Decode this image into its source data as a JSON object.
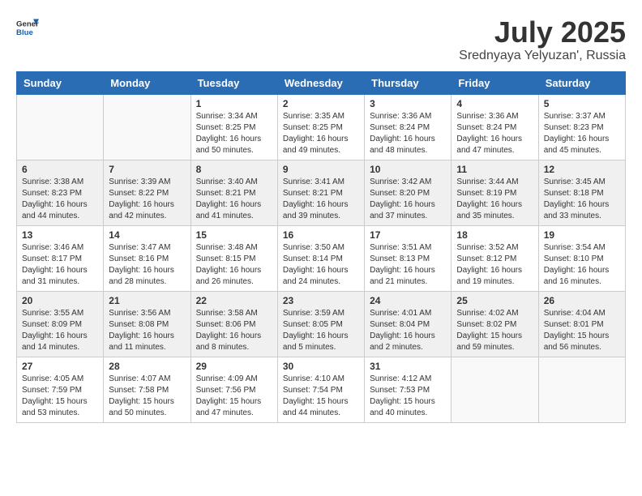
{
  "header": {
    "logo_line1": "General",
    "logo_line2": "Blue",
    "month_year": "July 2025",
    "location": "Srednyaya Yelyuzan', Russia"
  },
  "weekdays": [
    "Sunday",
    "Monday",
    "Tuesday",
    "Wednesday",
    "Thursday",
    "Friday",
    "Saturday"
  ],
  "weeks": [
    [
      {
        "day": "",
        "sunrise": "",
        "sunset": "",
        "daylight": ""
      },
      {
        "day": "",
        "sunrise": "",
        "sunset": "",
        "daylight": ""
      },
      {
        "day": "1",
        "sunrise": "Sunrise: 3:34 AM",
        "sunset": "Sunset: 8:25 PM",
        "daylight": "Daylight: 16 hours and 50 minutes."
      },
      {
        "day": "2",
        "sunrise": "Sunrise: 3:35 AM",
        "sunset": "Sunset: 8:25 PM",
        "daylight": "Daylight: 16 hours and 49 minutes."
      },
      {
        "day": "3",
        "sunrise": "Sunrise: 3:36 AM",
        "sunset": "Sunset: 8:24 PM",
        "daylight": "Daylight: 16 hours and 48 minutes."
      },
      {
        "day": "4",
        "sunrise": "Sunrise: 3:36 AM",
        "sunset": "Sunset: 8:24 PM",
        "daylight": "Daylight: 16 hours and 47 minutes."
      },
      {
        "day": "5",
        "sunrise": "Sunrise: 3:37 AM",
        "sunset": "Sunset: 8:23 PM",
        "daylight": "Daylight: 16 hours and 45 minutes."
      }
    ],
    [
      {
        "day": "6",
        "sunrise": "Sunrise: 3:38 AM",
        "sunset": "Sunset: 8:23 PM",
        "daylight": "Daylight: 16 hours and 44 minutes."
      },
      {
        "day": "7",
        "sunrise": "Sunrise: 3:39 AM",
        "sunset": "Sunset: 8:22 PM",
        "daylight": "Daylight: 16 hours and 42 minutes."
      },
      {
        "day": "8",
        "sunrise": "Sunrise: 3:40 AM",
        "sunset": "Sunset: 8:21 PM",
        "daylight": "Daylight: 16 hours and 41 minutes."
      },
      {
        "day": "9",
        "sunrise": "Sunrise: 3:41 AM",
        "sunset": "Sunset: 8:21 PM",
        "daylight": "Daylight: 16 hours and 39 minutes."
      },
      {
        "day": "10",
        "sunrise": "Sunrise: 3:42 AM",
        "sunset": "Sunset: 8:20 PM",
        "daylight": "Daylight: 16 hours and 37 minutes."
      },
      {
        "day": "11",
        "sunrise": "Sunrise: 3:44 AM",
        "sunset": "Sunset: 8:19 PM",
        "daylight": "Daylight: 16 hours and 35 minutes."
      },
      {
        "day": "12",
        "sunrise": "Sunrise: 3:45 AM",
        "sunset": "Sunset: 8:18 PM",
        "daylight": "Daylight: 16 hours and 33 minutes."
      }
    ],
    [
      {
        "day": "13",
        "sunrise": "Sunrise: 3:46 AM",
        "sunset": "Sunset: 8:17 PM",
        "daylight": "Daylight: 16 hours and 31 minutes."
      },
      {
        "day": "14",
        "sunrise": "Sunrise: 3:47 AM",
        "sunset": "Sunset: 8:16 PM",
        "daylight": "Daylight: 16 hours and 28 minutes."
      },
      {
        "day": "15",
        "sunrise": "Sunrise: 3:48 AM",
        "sunset": "Sunset: 8:15 PM",
        "daylight": "Daylight: 16 hours and 26 minutes."
      },
      {
        "day": "16",
        "sunrise": "Sunrise: 3:50 AM",
        "sunset": "Sunset: 8:14 PM",
        "daylight": "Daylight: 16 hours and 24 minutes."
      },
      {
        "day": "17",
        "sunrise": "Sunrise: 3:51 AM",
        "sunset": "Sunset: 8:13 PM",
        "daylight": "Daylight: 16 hours and 21 minutes."
      },
      {
        "day": "18",
        "sunrise": "Sunrise: 3:52 AM",
        "sunset": "Sunset: 8:12 PM",
        "daylight": "Daylight: 16 hours and 19 minutes."
      },
      {
        "day": "19",
        "sunrise": "Sunrise: 3:54 AM",
        "sunset": "Sunset: 8:10 PM",
        "daylight": "Daylight: 16 hours and 16 minutes."
      }
    ],
    [
      {
        "day": "20",
        "sunrise": "Sunrise: 3:55 AM",
        "sunset": "Sunset: 8:09 PM",
        "daylight": "Daylight: 16 hours and 14 minutes."
      },
      {
        "day": "21",
        "sunrise": "Sunrise: 3:56 AM",
        "sunset": "Sunset: 8:08 PM",
        "daylight": "Daylight: 16 hours and 11 minutes."
      },
      {
        "day": "22",
        "sunrise": "Sunrise: 3:58 AM",
        "sunset": "Sunset: 8:06 PM",
        "daylight": "Daylight: 16 hours and 8 minutes."
      },
      {
        "day": "23",
        "sunrise": "Sunrise: 3:59 AM",
        "sunset": "Sunset: 8:05 PM",
        "daylight": "Daylight: 16 hours and 5 minutes."
      },
      {
        "day": "24",
        "sunrise": "Sunrise: 4:01 AM",
        "sunset": "Sunset: 8:04 PM",
        "daylight": "Daylight: 16 hours and 2 minutes."
      },
      {
        "day": "25",
        "sunrise": "Sunrise: 4:02 AM",
        "sunset": "Sunset: 8:02 PM",
        "daylight": "Daylight: 15 hours and 59 minutes."
      },
      {
        "day": "26",
        "sunrise": "Sunrise: 4:04 AM",
        "sunset": "Sunset: 8:01 PM",
        "daylight": "Daylight: 15 hours and 56 minutes."
      }
    ],
    [
      {
        "day": "27",
        "sunrise": "Sunrise: 4:05 AM",
        "sunset": "Sunset: 7:59 PM",
        "daylight": "Daylight: 15 hours and 53 minutes."
      },
      {
        "day": "28",
        "sunrise": "Sunrise: 4:07 AM",
        "sunset": "Sunset: 7:58 PM",
        "daylight": "Daylight: 15 hours and 50 minutes."
      },
      {
        "day": "29",
        "sunrise": "Sunrise: 4:09 AM",
        "sunset": "Sunset: 7:56 PM",
        "daylight": "Daylight: 15 hours and 47 minutes."
      },
      {
        "day": "30",
        "sunrise": "Sunrise: 4:10 AM",
        "sunset": "Sunset: 7:54 PM",
        "daylight": "Daylight: 15 hours and 44 minutes."
      },
      {
        "day": "31",
        "sunrise": "Sunrise: 4:12 AM",
        "sunset": "Sunset: 7:53 PM",
        "daylight": "Daylight: 15 hours and 40 minutes."
      },
      {
        "day": "",
        "sunrise": "",
        "sunset": "",
        "daylight": ""
      },
      {
        "day": "",
        "sunrise": "",
        "sunset": "",
        "daylight": ""
      }
    ]
  ]
}
